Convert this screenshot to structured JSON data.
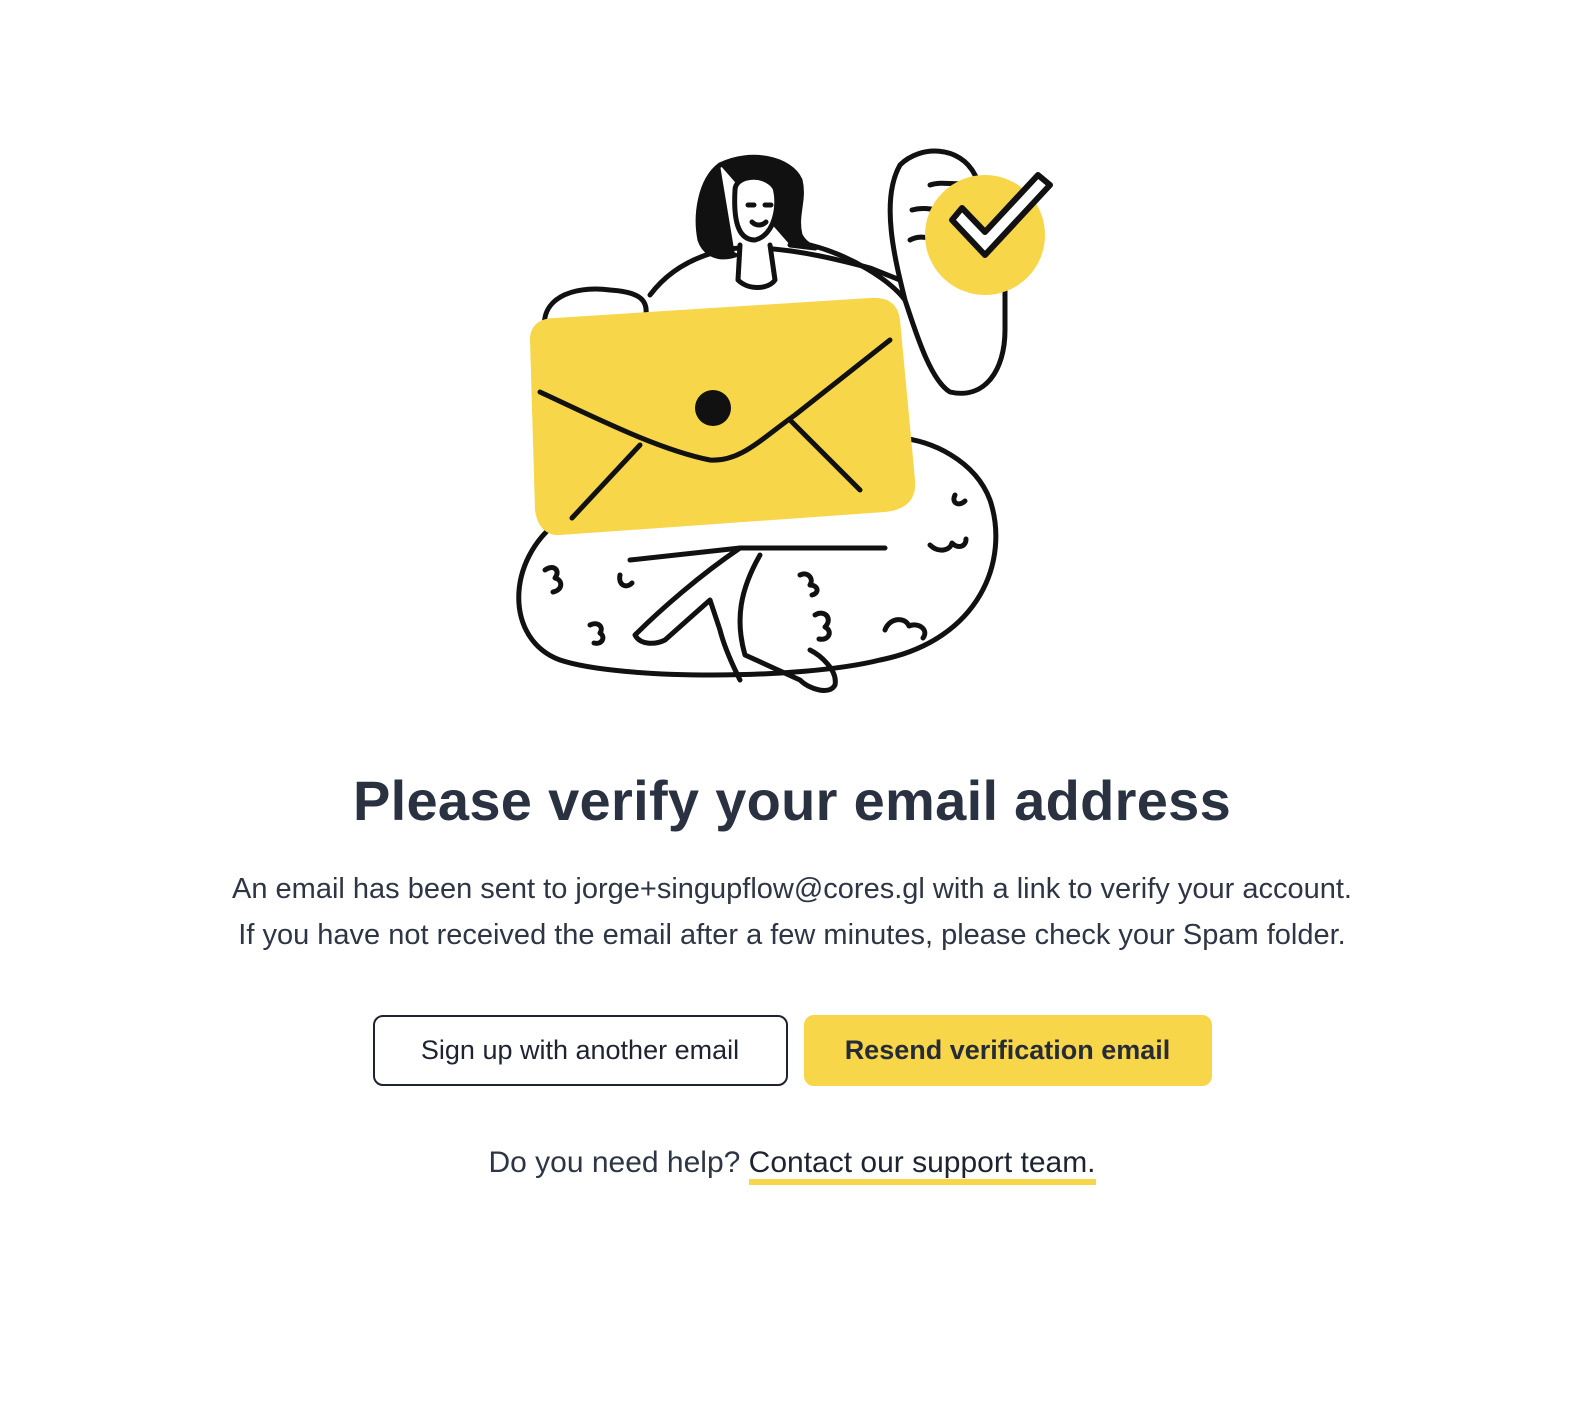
{
  "page": {
    "title": "Please verify your email address",
    "message_line1": "An email has been sent to jorge+singupflow@cores.gl with a link to verify your account.",
    "message_line2": "If you have not received the email after a few minutes, please check your Spam folder."
  },
  "actions": {
    "secondary_label": "Sign up with another email",
    "primary_label": "Resend verification email"
  },
  "help": {
    "prompt": "Do you need help?",
    "link_label": "Contact our support team."
  },
  "illustration": {
    "icon": "person-holding-envelope-illustration"
  },
  "colors": {
    "accent": "#f7d64a",
    "text": "#2a3140",
    "outline": "#1e2330"
  }
}
